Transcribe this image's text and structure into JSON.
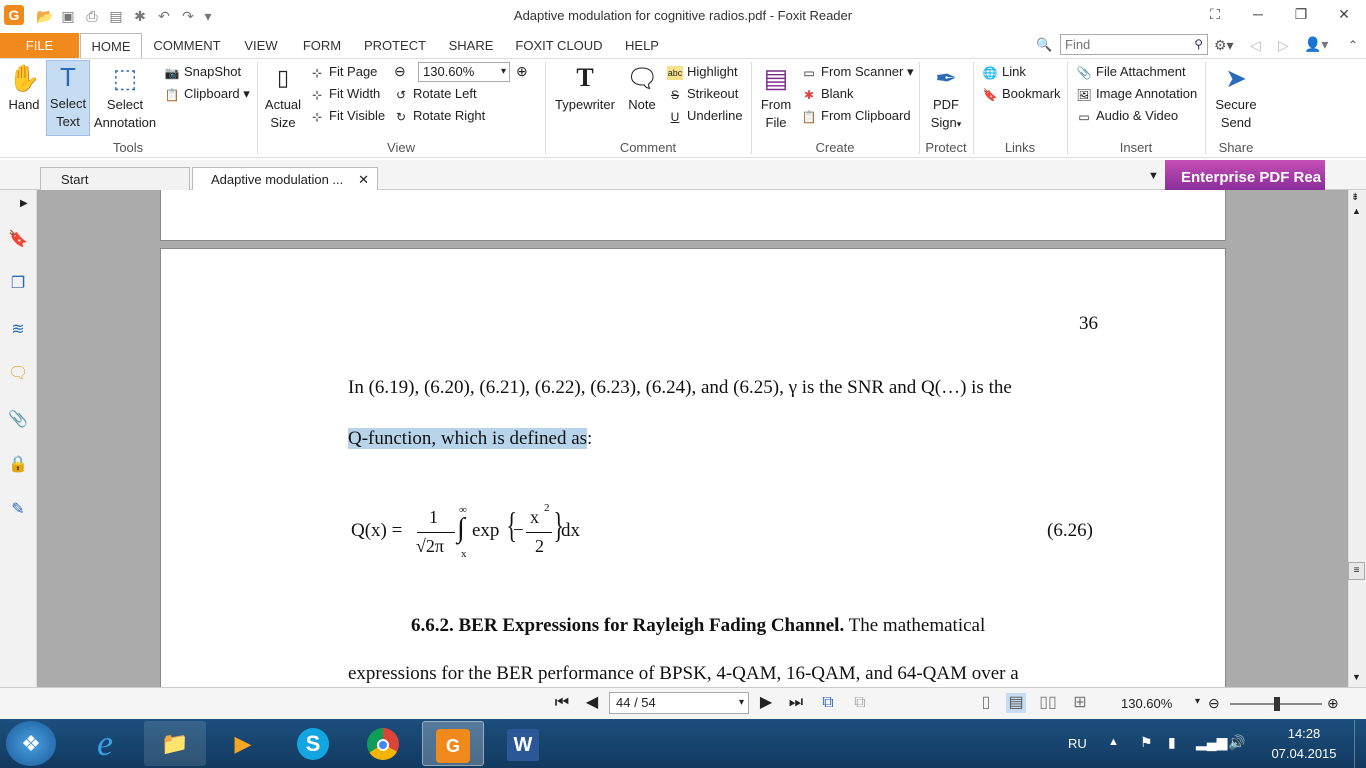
{
  "titlebar": {
    "title": "Adaptive modulation for cognitive radios.pdf - Foxit Reader",
    "app_icon": "G"
  },
  "menu": {
    "tabs": [
      "FILE",
      "HOME",
      "COMMENT",
      "VIEW",
      "FORM",
      "PROTECT",
      "SHARE",
      "FOXIT CLOUD",
      "HELP"
    ],
    "find_placeholder": "Find"
  },
  "ribbon": {
    "tools": {
      "group": "Tools",
      "hand": "Hand",
      "select_text_1": "Select",
      "select_text_2": "Text",
      "select_annot_1": "Select",
      "select_annot_2": "Annotation",
      "snapshot": "SnapShot",
      "clipboard": "Clipboard"
    },
    "view": {
      "group": "View",
      "actual_size_1": "Actual",
      "actual_size_2": "Size",
      "fit_page": "Fit Page",
      "fit_width": "Fit Width",
      "fit_visible": "Fit Visible",
      "zoom": "130.60%",
      "rotate_left": "Rotate Left",
      "rotate_right": "Rotate Right"
    },
    "comment": {
      "group": "Comment",
      "typewriter": "Typewriter",
      "note": "Note",
      "highlight": "Highlight",
      "strikeout": "Strikeout",
      "underline": "Underline"
    },
    "create": {
      "group": "Create",
      "from_file_1": "From",
      "from_file_2": "File",
      "from_scanner": "From Scanner",
      "blank": "Blank",
      "from_clipboard": "From Clipboard"
    },
    "protect": {
      "group": "Protect",
      "pdf_sign_1": "PDF",
      "pdf_sign_2": "Sign"
    },
    "links": {
      "group": "Links",
      "link": "Link",
      "bookmark": "Bookmark"
    },
    "insert": {
      "group": "Insert",
      "file_attachment": "File Attachment",
      "image_annotation": "Image Annotation",
      "audio_video": "Audio & Video"
    },
    "share": {
      "group": "Share",
      "secure_send_1": "Secure",
      "secure_send_2": "Send"
    }
  },
  "tabs": {
    "start": "Start",
    "doc": "Adaptive modulation ...",
    "banner": "Enterprise PDF Rea"
  },
  "document": {
    "page_number": "36",
    "para1_line1": "In (6.19), (6.20), (6.21), (6.22), (6.23), (6.24), and (6.25),  γ  is the SNR and Q(…) is the",
    "para1_line2_hl": "Q-function, which is defined as",
    "para1_line2_rest": ":",
    "eq_lhs": "Q(x) =",
    "eq_num": "1",
    "eq_den": "√2π",
    "eq_int_top": "∞",
    "eq_int_bot": "x",
    "eq_exp": "exp",
    "eq_minus": "−",
    "eq_xsq": "x",
    "eq_sup": "2",
    "eq_two": "2",
    "eq_dx": "dx",
    "eq_label": "(6.26)",
    "section_head": "6.6.2. BER Expressions for Rayleigh Fading Channel.",
    "section_rest": " The mathematical",
    "para2_line1": "expressions for the BER performance of BPSK, 4-QAM, 16-QAM, and 64-QAM over a"
  },
  "statusbar": {
    "page": "44 / 54",
    "zoom": "130.60%"
  },
  "taskbar": {
    "lang": "RU",
    "time": "14:28",
    "date": "07.04.2015"
  }
}
